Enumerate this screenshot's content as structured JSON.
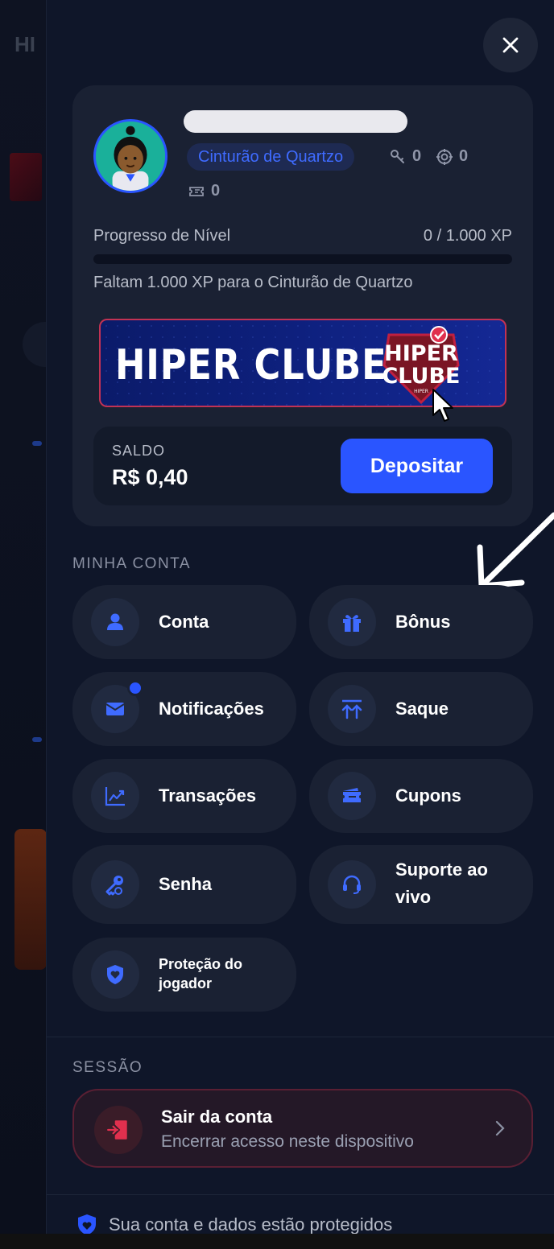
{
  "profile": {
    "tier": "Cinturão de Quartzo",
    "keys": "0",
    "coins": "0",
    "tickets": "0"
  },
  "progress": {
    "label": "Progresso de Nível",
    "value": "0 / 1.000 XP",
    "fraction": 0,
    "hint": "Faltam 1.000 XP para o Cinturão de Quartzo"
  },
  "club": {
    "banner_text": "HIPER CLUBE",
    "logo_line1": "HIPER",
    "logo_line2": "CLUBE",
    "logo_small": "HIPER"
  },
  "balance": {
    "label": "SALDO",
    "value": "R$ 0,40",
    "deposit_label": "Depositar"
  },
  "account_section": {
    "title": "MINHA CONTA",
    "items": [
      {
        "label": "Conta",
        "icon": "user-icon"
      },
      {
        "label": "Bônus",
        "icon": "gift-icon"
      },
      {
        "label": "Notificações",
        "icon": "mail-icon"
      },
      {
        "label": "Saque",
        "icon": "withdraw-icon"
      },
      {
        "label": "Transações",
        "icon": "chart-icon"
      },
      {
        "label": "Cupons",
        "icon": "coupon-icon"
      },
      {
        "label": "Senha",
        "icon": "key-icon"
      },
      {
        "label": "Suporte ao vivo",
        "icon": "headset-icon"
      },
      {
        "label": "Proteção do jogador",
        "icon": "shield-heart-icon"
      }
    ]
  },
  "session_section": {
    "title": "SESSÃO",
    "logout_title": "Sair da conta",
    "logout_subtitle": "Encerrar acesso neste dispositivo"
  },
  "footer": {
    "text": "Sua conta e dados estão protegidos"
  },
  "colors": {
    "accent": "#2a55ff",
    "panel": "#1a2133",
    "drawer": "#0f1629",
    "danger": "#e0304e"
  }
}
